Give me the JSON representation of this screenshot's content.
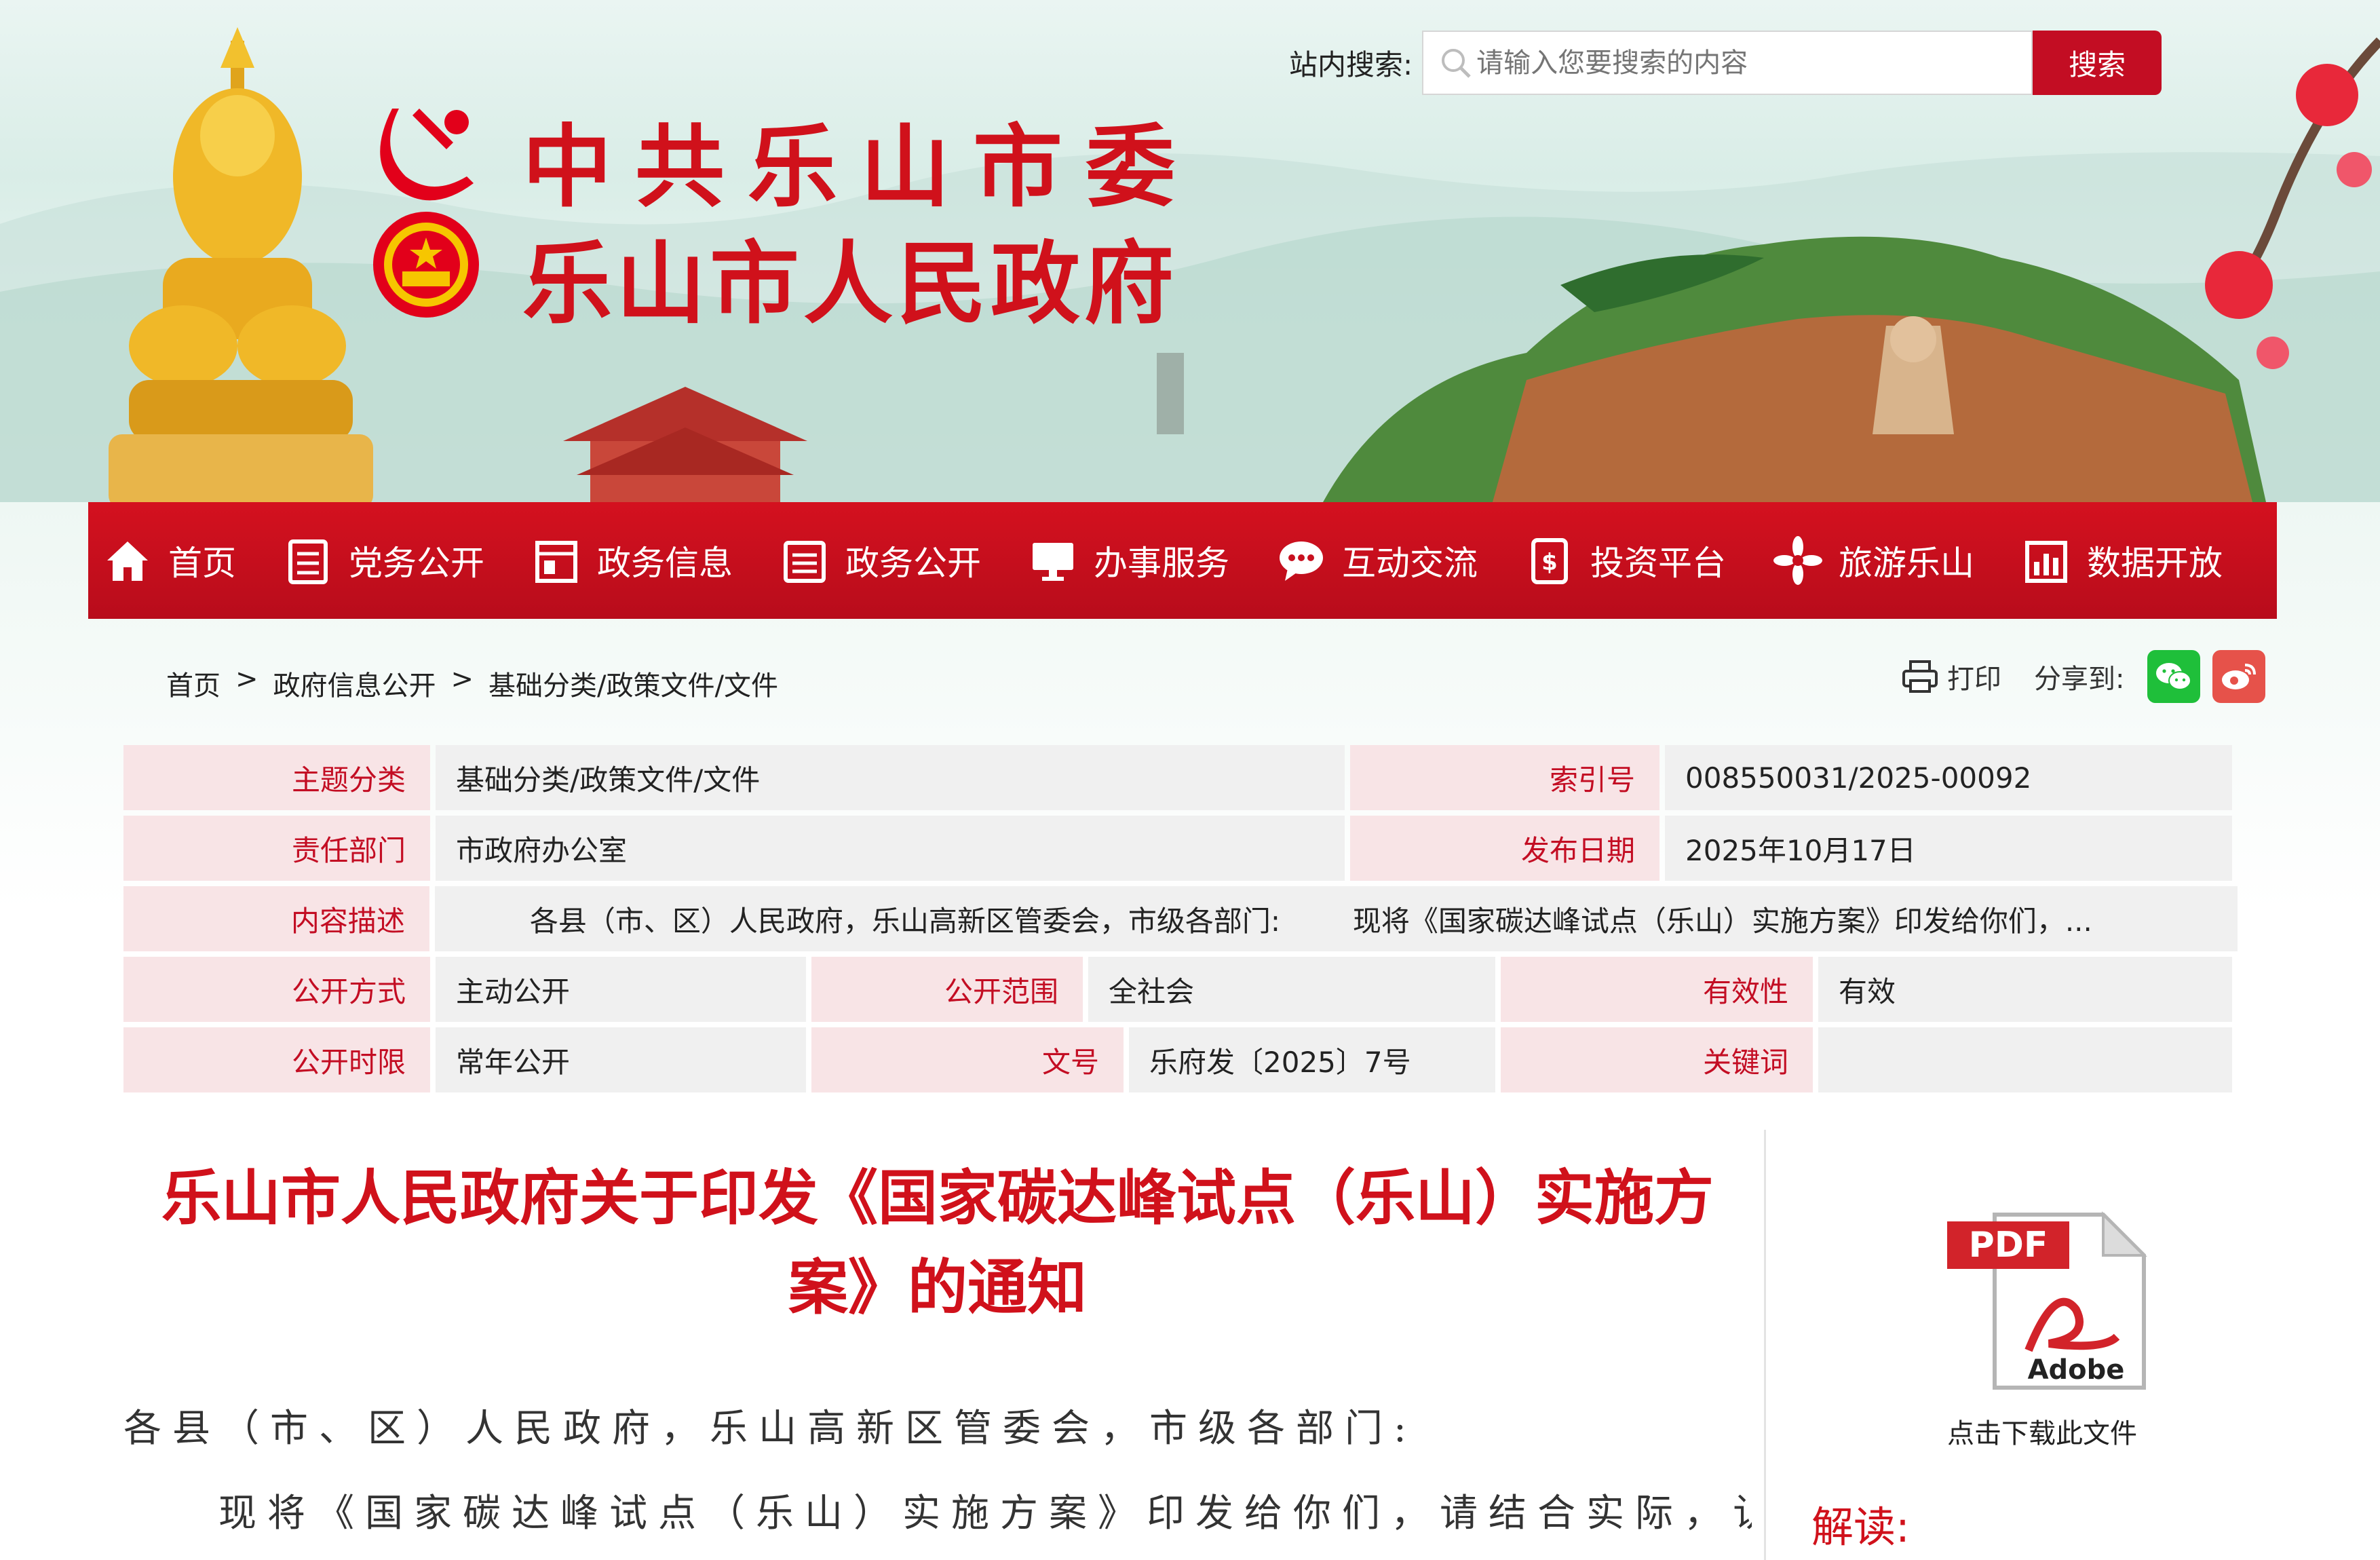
{
  "header": {
    "title_line1": "中共乐山市委",
    "title_line2": "乐山市人民政府",
    "search_label": "站内搜索:",
    "search_placeholder": "请输入您要搜索的内容",
    "search_button": "搜索"
  },
  "nav": {
    "items": [
      {
        "label": "首页",
        "icon": "home-icon"
      },
      {
        "label": "党务公开",
        "icon": "document-icon"
      },
      {
        "label": "政务信息",
        "icon": "window-icon"
      },
      {
        "label": "政务公开",
        "icon": "list-icon"
      },
      {
        "label": "办事服务",
        "icon": "monitor-icon"
      },
      {
        "label": "互动交流",
        "icon": "chat-icon"
      },
      {
        "label": "投资平台",
        "icon": "money-icon"
      },
      {
        "label": "旅游乐山",
        "icon": "flower-icon"
      },
      {
        "label": "数据开放",
        "icon": "bar-chart-icon"
      }
    ]
  },
  "breadcrumb": {
    "home": "首页",
    "sep1": ">",
    "level1": "政府信息公开",
    "sep2": ">",
    "level2": "基础分类/政策文件/文件"
  },
  "tools": {
    "print": "打印",
    "share": "分享到:"
  },
  "meta": {
    "topic_label": "主题分类",
    "topic_value": "基础分类/政策文件/文件",
    "index_label": "索引号",
    "index_value": "008550031/2025-00092",
    "dept_label": "责任部门",
    "dept_value": "市政府办公室",
    "date_label": "发布日期",
    "date_value": "2025年10月17日",
    "desc_label": "内容描述",
    "desc_value": "各县（市、区）人民政府，乐山高新区管委会，市级各部门:        现将《国家碳达峰试点（乐山）实施方案》印发给你们，...",
    "mode_label": "公开方式",
    "mode_value": "主动公开",
    "scope_label": "公开范围",
    "scope_value": "全社会",
    "validity_label": "有效性",
    "validity_value": "有效",
    "period_label": "公开时限",
    "period_value": "常年公开",
    "docno_label": "文号",
    "docno_value": "乐府发〔2025〕7号",
    "keyword_label": "关键词",
    "keyword_value": ""
  },
  "article": {
    "title": "乐山市人民政府关于印发《国家碳达峰试点（乐山）实施方案》的通知",
    "para1": "各县（市、区）人民政府，乐山高新区管委会，市级各部门:",
    "para2": "现将《国家碳达峰试点（乐山）实施方案》印发给你们，请结合实际，认"
  },
  "sidebar": {
    "pdf_badge": "PDF",
    "pdf_brand": "Adobe",
    "download_caption": "点击下载此文件",
    "interpret_label": "解读:"
  },
  "colors": {
    "brand_red": "#c30d23",
    "nav_red": "#c8101f",
    "label_bg": "#f8e4e6",
    "value_bg": "#f0f0f0"
  }
}
